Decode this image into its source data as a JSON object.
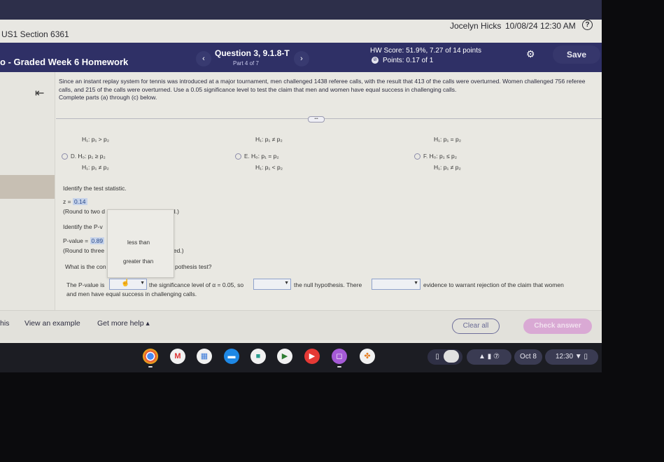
{
  "header": {
    "course": "US1 Section 6361",
    "user": "Jocelyn Hicks",
    "datetime": "10/08/24 12:30 AM",
    "help_icon": "question-circle-icon"
  },
  "navbar": {
    "hw_title": "o - Graded Week 6 Homework",
    "prev_label": "‹",
    "next_label": "›",
    "question_title": "Question 3, 9.1.8-T",
    "question_part": "Part 4 of 7",
    "hw_score": "HW Score: 51.9%, 7.27 of 14 points",
    "points": "Points: 0.17 of 1",
    "save_label": "Save"
  },
  "question": {
    "text": "Since an instant replay system for tennis was introduced at a major tournament, men challenged 1438 referee calls, with the result that 413 of the calls were overturned. Women challenged 756 referee calls, and 215 of the calls were overturned. Use a 0.05 significance level to test the claim that men and women have equal success in challenging calls.",
    "instructions": "Complete parts (a) through (c) below."
  },
  "options_top": [
    {
      "h1": "H₁: p₁ > p₂"
    },
    {
      "h1": "H₁: p₁ ≠ p₂"
    },
    {
      "h1": "H₁: p₁ = p₂"
    }
  ],
  "options": [
    {
      "letter": "D.",
      "h0": "H₀: p₁ ≥ p₂",
      "h1": "H₁: p₁ ≠ p₂"
    },
    {
      "letter": "E.",
      "h0": "H₀: p₁ = p₂",
      "h1": "H₁: p₁ < p₂"
    },
    {
      "letter": "F.",
      "h0": "H₀: p₁ ≤ p₂",
      "h1": "H₁: p₁ ≠ p₂"
    }
  ],
  "test_stat": {
    "prompt": "Identify the test statistic.",
    "label": "z =",
    "value": "0.14",
    "round_note_start": "(Round to two d",
    "round_note_end": "d.)"
  },
  "pvalue": {
    "prompt": "Identify the P-v",
    "label": "P-value =",
    "value": "0.89",
    "round_note_start": "(Round to three",
    "round_note_end": "led.)"
  },
  "conclusion": {
    "prompt_start": "What is the con",
    "prompt_end": "pothesis test?",
    "sentence_1": "The P-value is",
    "sentence_2": "the significance level of α = 0.05, so",
    "sentence_3": "the null hypothesis. There",
    "sentence_4": "evidence to warrant rejection of the claim that women",
    "sentence_5": "and men have equal success in challenging calls."
  },
  "popup_options": [
    "less than",
    "greater than"
  ],
  "footer": {
    "help_partial": "his",
    "view_example": "View an example",
    "get_help": "Get more help ▴",
    "clear_all": "Clear all",
    "check_answer": "Check answer"
  },
  "shelf": {
    "apps": [
      "chrome-icon",
      "gmail-icon",
      "docs-icon",
      "files-icon",
      "meet-icon",
      "play-store-icon",
      "youtube-icon",
      "camera-app-icon",
      "photos-icon"
    ],
    "date": "Oct 8",
    "time": "12:30"
  }
}
